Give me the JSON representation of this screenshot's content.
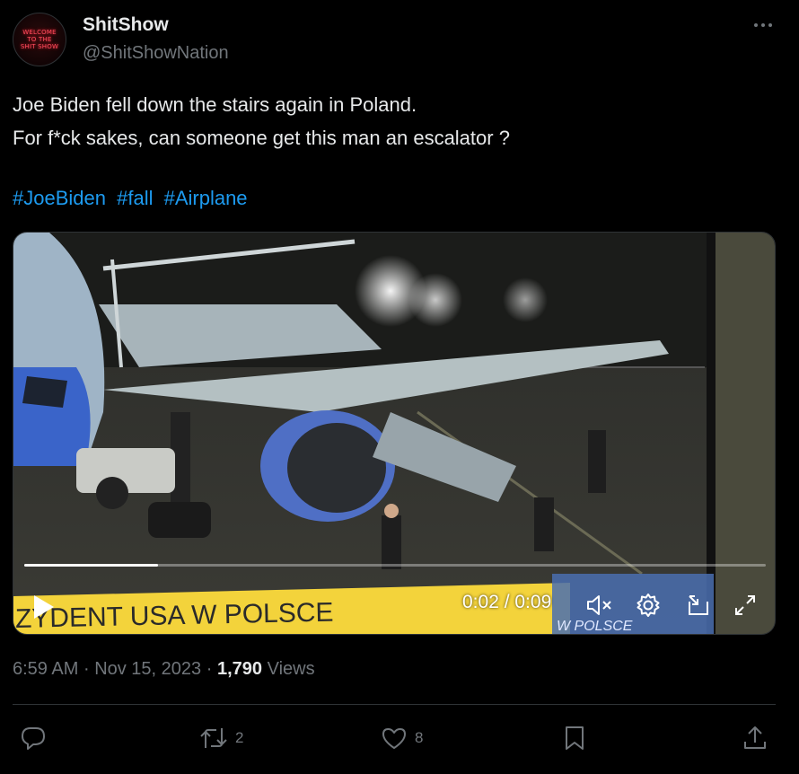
{
  "author": {
    "display_name": "ShitShow",
    "handle": "@ShitShowNation",
    "avatar_text": [
      "WELCOME",
      "TO THE",
      "SHIT SHOW"
    ]
  },
  "tweet": {
    "line1": "Joe Biden fell down the stairs again in Poland.",
    "line2": "For f*ck sakes, can someone get this man an escalator ?",
    "hashtags": [
      "#JoeBiden",
      "#fall",
      "#Airplane"
    ]
  },
  "video": {
    "time_display": "0:02 / 0:09",
    "progress": 0.18,
    "banner_text": "ZYDENT USA W POLSCE",
    "banner_subtext": "W POLSCE"
  },
  "meta": {
    "time": "6:59 AM",
    "separator": "·",
    "date": "Nov 15, 2023",
    "views_count": "1,790",
    "views_label": "Views"
  },
  "actions": {
    "reply_count": "",
    "retweet_count": "2",
    "like_count": "8"
  },
  "colors": {
    "accent": "#1d9bf0",
    "muted": "#71767b",
    "text": "#e7e9ea",
    "background": "#000000"
  },
  "icons": [
    "more-icon",
    "play-icon",
    "mute-icon",
    "settings-icon",
    "pip-icon",
    "fullscreen-icon",
    "reply-icon",
    "retweet-icon",
    "like-icon",
    "bookmark-icon",
    "share-icon"
  ]
}
